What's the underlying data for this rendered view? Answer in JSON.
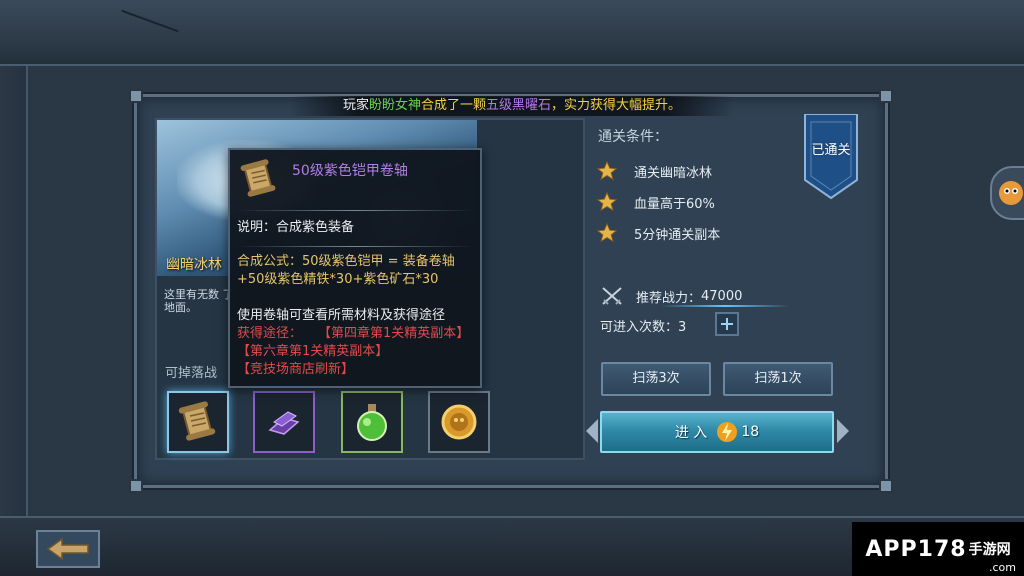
{
  "announcement": {
    "prefix": "玩家",
    "player": "盼盼女神",
    "action": "合成了一颗",
    "item": "五级黑曜石",
    "suffix": "，实力获得大幅提升。"
  },
  "stage": {
    "name": "幽暗冰林",
    "description": "这里有无数 了地面。",
    "drops_label": "可掉落战"
  },
  "drops": [
    {
      "icon": "scroll-icon",
      "selected": true
    },
    {
      "icon": "purple-shard-icon",
      "selected": false
    },
    {
      "icon": "green-potion-icon",
      "selected": false
    },
    {
      "icon": "gold-coin-icon",
      "selected": false
    }
  ],
  "tooltip": {
    "title": "50级紫色铠甲卷轴",
    "description": "说明：合成紫色装备",
    "formula_line1": "合成公式：50级紫色铠甲 = 装备卷轴",
    "formula_line2": "+50级紫色精铁*30+紫色矿石*30",
    "usage": "使用卷轴可查看所需材料及获得途径",
    "source_label": "获得途径：",
    "sources": [
      "【第四章第1关精英副本】",
      "【第六章第1关精英副本】",
      "【竞技场商店刷新】"
    ]
  },
  "conditions": {
    "title": "通关条件：",
    "items": [
      "通关幽暗冰林",
      "血量高于60%",
      "5分钟通关副本"
    ],
    "cleared_badge": "已通关"
  },
  "power": {
    "label": "推荐战力：",
    "value": "47000"
  },
  "entries": {
    "label": "可进入次数：",
    "value": "3"
  },
  "buttons": {
    "sweep3": "扫荡3次",
    "sweep1": "扫荡1次",
    "enter": "进 入",
    "enter_cost": "18"
  },
  "watermark": {
    "main": "APP178",
    "sub": "手游网",
    "domain": ".com"
  },
  "colors": {
    "accent": "#57b3cd",
    "player_name": "#69d24a",
    "item_name": "#b47be8",
    "highlight": "#f5d245",
    "source": "#e24b4b"
  }
}
